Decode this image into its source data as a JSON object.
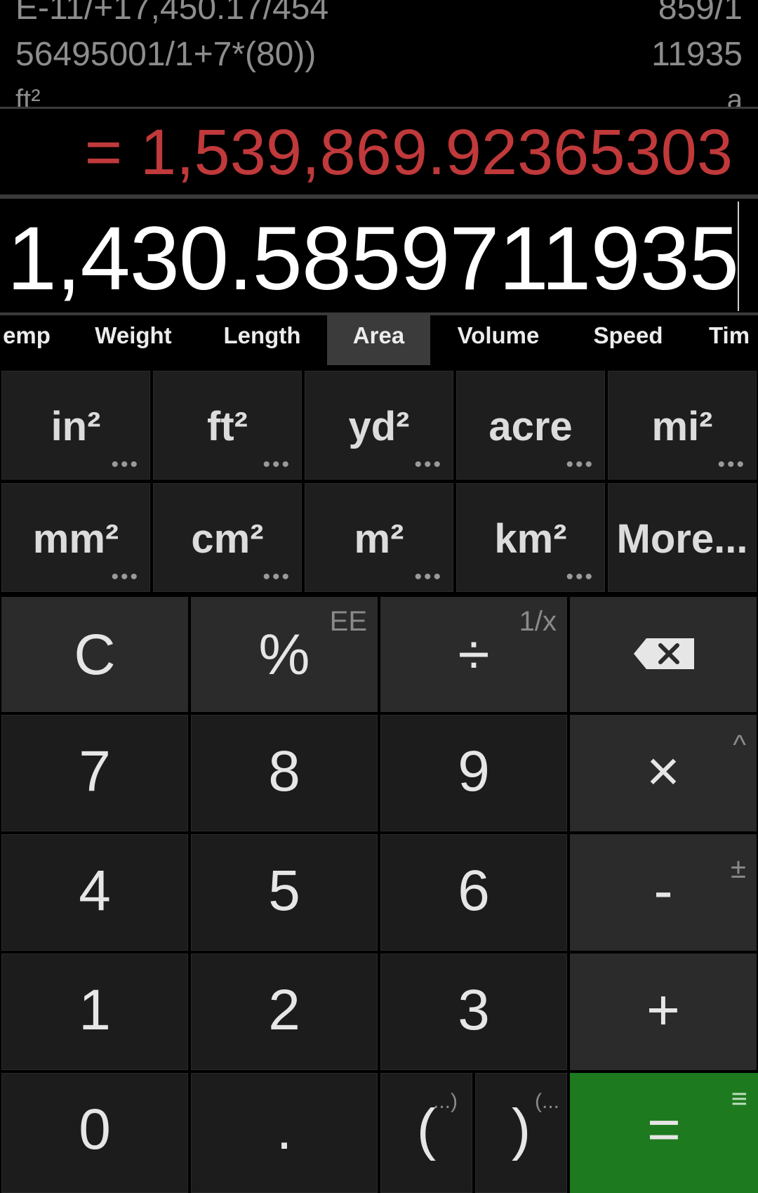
{
  "history": {
    "line1_left": "E-11/+17,450.17/454",
    "line1_right": "859/1",
    "line2_left": "56495001/1+7*(80))",
    "line2_right": "11935",
    "line3_left": "ft²",
    "line3_right": "a"
  },
  "result": "= 1,539,869.92365303",
  "input": "1,430.5859711935",
  "tabs": [
    {
      "label": "emp"
    },
    {
      "label": "Weight"
    },
    {
      "label": "Length"
    },
    {
      "label": "Area",
      "active": true
    },
    {
      "label": "Volume"
    },
    {
      "label": "Speed"
    },
    {
      "label": "Tim"
    }
  ],
  "units": [
    {
      "label": "in²",
      "dots": "•••"
    },
    {
      "label": "ft²",
      "dots": "•••"
    },
    {
      "label": "yd²",
      "dots": "•••"
    },
    {
      "label": "acre",
      "dots": "•••"
    },
    {
      "label": "mi²",
      "dots": "•••"
    },
    {
      "label": "mm²",
      "dots": "•••"
    },
    {
      "label": "cm²",
      "dots": "•••"
    },
    {
      "label": "m²",
      "dots": "•••"
    },
    {
      "label": "km²",
      "dots": "•••"
    },
    {
      "label": "More..."
    }
  ],
  "keys": {
    "clear": "C",
    "percent": "%",
    "percent_alt": "EE",
    "divide": "÷",
    "divide_alt": "1/x",
    "backspace": "⌫",
    "seven": "7",
    "eight": "8",
    "nine": "9",
    "multiply": "×",
    "multiply_alt": "^",
    "four": "4",
    "five": "5",
    "six": "6",
    "minus": "-",
    "minus_alt": "±",
    "one": "1",
    "two": "2",
    "three": "3",
    "plus": "+",
    "zero": "0",
    "dot": ".",
    "open_paren": "(",
    "open_paren_alt": "...)",
    "close_paren": ")",
    "close_paren_alt": "(...",
    "equals": "=",
    "equals_alt": "≡"
  },
  "colors": {
    "result": "#c0393b",
    "equals_key": "#1e7a1e",
    "active_tab": "#3b3b3b"
  }
}
